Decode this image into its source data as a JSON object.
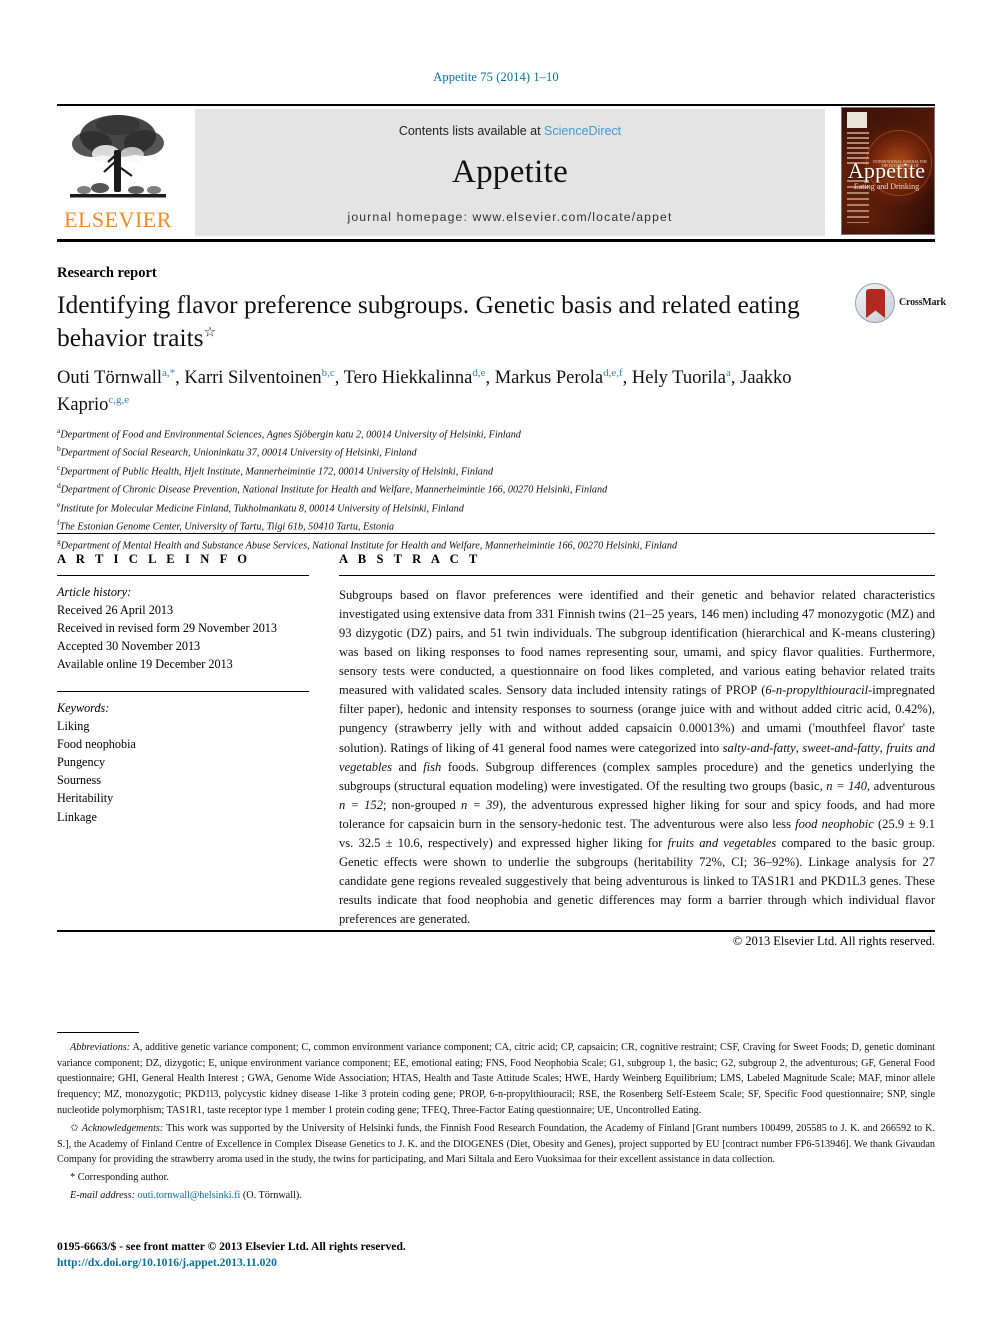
{
  "running_head": "Appetite 75 (2014) 1–10",
  "masthead": {
    "publisher": "ELSEVIER",
    "contents_prefix": "Contents lists available at ",
    "contents_link": "ScienceDirect",
    "journal_name": "Appetite",
    "homepage": "journal homepage: www.elsevier.com/locate/appet",
    "cover_title": "Appetite",
    "cover_subtitle": "Eating and Drinking",
    "cover_top_label": "INTERNATIONAL JOURNAL FOR THE PSYCHOLOGY OF"
  },
  "article": {
    "kind": "Research report",
    "title": "Identifying flavor preference subgroups. Genetic basis and related eating behavior traits",
    "title_footnote_mark": "☆",
    "crossmark_label": "CrossMark",
    "authors_line1": "Outi Törnwall",
    "authors_html_segments": [
      {
        "name": "Outi Törnwall",
        "sup": "a,*",
        "sep": ", "
      },
      {
        "name": "Karri Silventoinen",
        "sup": "b,c",
        "sep": ", "
      },
      {
        "name": "Tero Hiekkalinna",
        "sup": "d,e",
        "sep": ", "
      },
      {
        "name": "Markus Perola",
        "sup": "d,e,f",
        "sep": ", "
      },
      {
        "name": "Hely Tuorila",
        "sup": "a",
        "sep": ", "
      },
      {
        "name": "Jaakko Kaprio",
        "sup": "c,g,e",
        "sep": ""
      }
    ],
    "affiliations": [
      {
        "mark": "a",
        "text": "Department of Food and Environmental Sciences, Agnes Sjöbergin katu 2, 00014 University of Helsinki, Finland"
      },
      {
        "mark": "b",
        "text": "Department of Social Research, Unioninkatu 37, 00014 University of Helsinki, Finland"
      },
      {
        "mark": "c",
        "text": "Department of Public Health, Hjelt Institute, Mannerheimintie 172, 00014 University of Helsinki, Finland"
      },
      {
        "mark": "d",
        "text": "Department of Chronic Disease Prevention, National Institute for Health and Welfare, Mannerheimintie 166, 00270 Helsinki, Finland"
      },
      {
        "mark": "e",
        "text": "Institute for Molecular Medicine Finland, Tukholmankatu 8, 00014 University of Helsinki, Finland"
      },
      {
        "mark": "f",
        "text": "The Estonian Genome Center, University of Tartu, Tiigi 61b, 50410 Tartu, Estonia"
      },
      {
        "mark": "g",
        "text": "Department of Mental Health and Substance Abuse Services, National Institute for Health and Welfare, Mannerheimintie 166, 00270 Helsinki, Finland"
      }
    ]
  },
  "article_info": {
    "heading": "A R T I C L E    I N F O",
    "history_label": "Article history:",
    "history": [
      "Received 26 April 2013",
      "Received in revised form 29 November 2013",
      "Accepted 30 November 2013",
      "Available online 19 December 2013"
    ],
    "keywords_label": "Keywords:",
    "keywords": [
      "Liking",
      "Food neophobia",
      "Pungency",
      "Sourness",
      "Heritability",
      "Linkage"
    ]
  },
  "abstract": {
    "heading": "A B S T R A C T",
    "paragraphs": [
      "Subgroups based on flavor preferences were identified and their genetic and behavior related characteristics investigated using extensive data from 331 Finnish twins (21–25 years, 146 men) including 47 monozygotic (MZ) and 93 dizygotic (DZ) pairs, and 51 twin individuals. The subgroup identification (hierarchical and K-means clustering) was based on liking responses to food names representing sour, umami, and spicy flavor qualities. Furthermore, sensory tests were conducted, a questionnaire on food likes completed, and various eating behavior related traits measured with validated scales. Sensory data included intensity ratings of PROP (6-n-propylthiouracil-impregnated filter paper), hedonic and intensity responses to sourness (orange juice with and without added citric acid, 0.42%), pungency (strawberry jelly with and without added capsaicin 0.00013%) and umami ('mouthfeel flavor' taste solution). Ratings of liking of 41 general food names were categorized into salty-and-fatty, sweet-and-fatty, fruits and vegetables and fish foods. Subgroup differences (complex samples procedure) and the genetics underlying the subgroups (structural equation modeling) were investigated. Of the resulting two groups (basic, n = 140, adventurous n = 152; non-grouped n = 39), the adventurous expressed higher liking for sour and spicy foods, and had more tolerance for capsaicin burn in the sensory-hedonic test. The adventurous were also less food neophobic (25.9 ± 9.1 vs. 32.5 ± 10.6, respectively) and expressed higher liking for fruits and vegetables compared to the basic group. Genetic effects were shown to underlie the subgroups (heritability 72%, CI; 36–92%). Linkage analysis for 27 candidate gene regions revealed suggestively that being adventurous is linked to TAS1R1 and PKD1L3 genes. These results indicate that food neophobia and genetic differences may form a barrier through which individual flavor preferences are generated."
    ],
    "copyright": "© 2013 Elsevier Ltd. All rights reserved."
  },
  "footnotes": {
    "abbreviations_label": "Abbreviations:",
    "abbreviations_text": " A, additive genetic variance component; C, common environment variance component; CA, citric acid; CP, capsaicin; CR, cognitive restraint; CSF, Craving for Sweet Foods; D, genetic dominant variance component; DZ, dizygotic; E, unique environment variance component; EE, emotional eating; FNS, Food Neophobia Scale; G1, subgroup 1, the basic; G2, subgroup 2, the adventurous; GF, General Food questionnaire; GHI, General Health Interest ; GWA, Genome Wide Association; HTAS, Health and Taste Attitude Scales; HWE, Hardy Weinberg Equilibrium; LMS, Labeled Magnitude Scale; MAF, minor allele frequency; MZ, monozygotic; PKD1l3, polycystic kidney disease 1-like 3 protein coding gene; PROP, 6-n-propylthiouracil; RSE, the Rosenberg Self-Esteem Scale; SF, Specific Food questionnaire; SNP, single nucleotide polymorphism; TAS1R1, taste receptor type 1 member 1 protein coding gene; TFEQ, Three-Factor Eating questionnaire; UE, Uncontrolled Eating.",
    "ack_marker": "✩",
    "ack_label": "Acknowledgements:",
    "ack_text": " This work was supported by the University of Helsinki funds, the Finnish Food Research Foundation, the Academy of Finland [Grant numbers 100499, 205585 to J. K. and 266592 to K. S.], the Academy of Finland Centre of Excellence in Complex Disease Genetics to J. K. and the DIOGENES (Diet, Obesity and Genes), project supported by EU [contract number FP6-513946]. We thank Givaudan Company for providing the strawberry aroma used in the study, the twins for participating, and Mari Siltala and Eero Vuoksimaa for their excellent assistance in data collection.",
    "corr_marker": "*",
    "corr_text": "Corresponding author.",
    "email_label": "E-mail address:",
    "email": "outi.tornwall@helsinki.fi",
    "email_suffix": " (O. Törnwall)."
  },
  "bottom": {
    "issn": "0195-6663/$ - see front matter © 2013 Elsevier Ltd. All rights reserved.",
    "doi": "http://dx.doi.org/10.1016/j.appet.2013.11.020"
  },
  "colors": {
    "link_blue": "#0b6d9e",
    "sciencedirect_blue": "#3f9ad4",
    "elsevier_orange": "#f08a24",
    "superscript_blue": "#2f83b4",
    "banner_gray": "#e4e4e4"
  }
}
